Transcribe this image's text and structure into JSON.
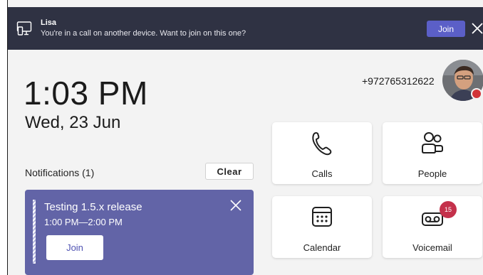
{
  "banner": {
    "caller": "Lisa",
    "message": "You're in a call on another device. Want to join on this one?",
    "join_label": "Join",
    "icon": "device-transfer-icon"
  },
  "clock": {
    "time": "1:03 PM",
    "date": "Wed, 23 Jun"
  },
  "profile": {
    "phone": "+972765312622",
    "presence": "busy",
    "presence_color": "#d13438"
  },
  "notifications": {
    "title": "Notifications (1)",
    "clear_label": "Clear",
    "items": [
      {
        "title": "Testing 1.5.x release",
        "time": "1:00 PM—2:00 PM",
        "join_label": "Join"
      }
    ]
  },
  "tiles": [
    {
      "label": "Calls",
      "icon": "phone-icon"
    },
    {
      "label": "People",
      "icon": "people-icon"
    },
    {
      "label": "Calendar",
      "icon": "calendar-icon"
    },
    {
      "label": "Voicemail",
      "icon": "voicemail-icon",
      "badge": "15"
    }
  ],
  "colors": {
    "banner_bg": "#2f3243",
    "accent": "#5b5fc7",
    "card_bg": "#6264a7",
    "badge": "#c4314b"
  }
}
